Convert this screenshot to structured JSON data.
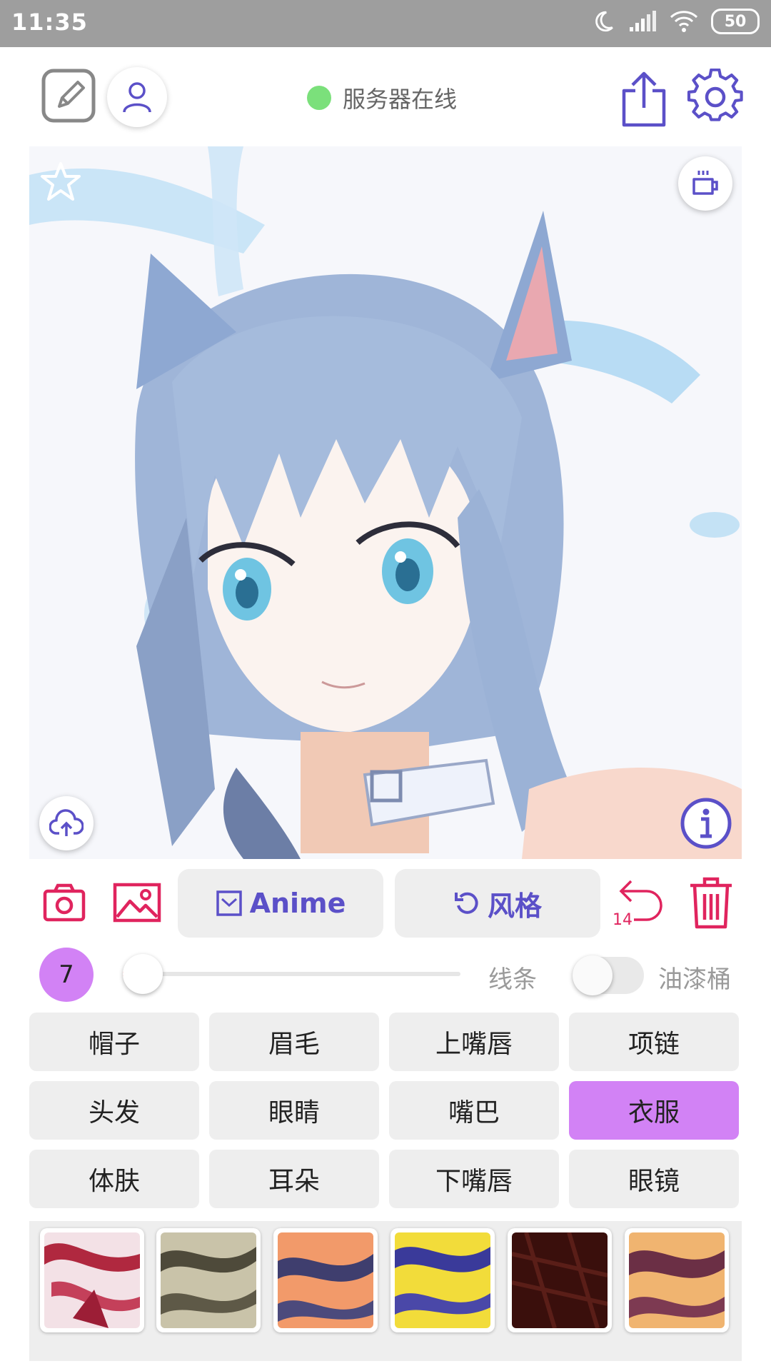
{
  "status_bar": {
    "time": "11:35",
    "battery": "50"
  },
  "header": {
    "server_status": "服务器在线"
  },
  "tools": {
    "anime_label": "Anime",
    "style_label": "风格",
    "undo_count": "14"
  },
  "brush": {
    "size": "7",
    "lines_label": "线条",
    "bucket_label": "油漆桶"
  },
  "parts": [
    {
      "label": "帽子"
    },
    {
      "label": "眉毛"
    },
    {
      "label": "上嘴唇"
    },
    {
      "label": "项链"
    },
    {
      "label": "头发"
    },
    {
      "label": "眼睛"
    },
    {
      "label": "嘴巴"
    },
    {
      "label": "衣服"
    },
    {
      "label": "体肤"
    },
    {
      "label": "耳朵"
    },
    {
      "label": "下嘴唇"
    },
    {
      "label": "眼镜"
    }
  ],
  "selected_part": "衣服",
  "colors": {
    "accent": "#d282f5",
    "primary_icon": "#5b50c8",
    "danger": "#e0245e",
    "online": "#7be07b"
  },
  "icons": [
    "edit-icon",
    "user-icon",
    "share-icon",
    "settings-icon",
    "star-icon",
    "coffee-icon",
    "upload-cloud-icon",
    "info-icon",
    "camera-icon",
    "image-icon",
    "checkbox-icon",
    "refresh-icon",
    "undo-icon",
    "trash-icon"
  ]
}
